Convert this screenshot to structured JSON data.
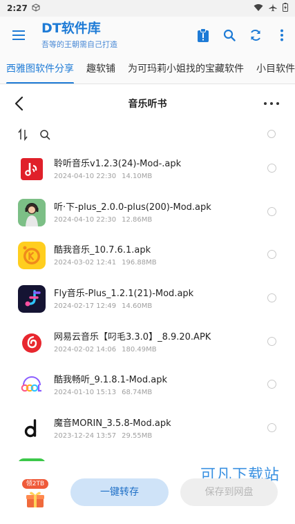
{
  "status_bar": {
    "time": "2:27"
  },
  "app_bar": {
    "title": "DT软件库",
    "subtitle": "吾等的王朝需自己打造"
  },
  "tabs": [
    {
      "label": "西雅图软件分享",
      "active": true
    },
    {
      "label": "趣软铺",
      "active": false
    },
    {
      "label": "为可玛莉小姐找的宝藏软件",
      "active": false
    },
    {
      "label": "小目软件",
      "active": false
    }
  ],
  "folder": {
    "title": "音乐听书"
  },
  "files": [
    {
      "name": "聆听音乐v1.2.3(24)-Mod-.apk",
      "date": "2024-04-10 22:30",
      "size": "14.10MB",
      "icon": "music-note-red-icon"
    },
    {
      "name": "听·下-plus_2.0.0-plus(200)-Mod.apk",
      "date": "2024-04-10 22:30",
      "size": "12.86MB",
      "icon": "girl-headphones-avatar-icon"
    },
    {
      "name": "酷我音乐_10.7.6.1.apk",
      "date": "2024-03-02 12:41",
      "size": "196.88MB",
      "icon": "kuwo-k-icon"
    },
    {
      "name": "Fly音乐-Plus_1.2.1(21)-Mod.apk",
      "date": "2024-02-17 12:49",
      "size": "14.60MB",
      "icon": "fly-f-icon"
    },
    {
      "name": "网易云音乐【叼毛3.3.0】_8.9.20.APK",
      "date": "2024-02-02 14:06",
      "size": "180.49MB",
      "icon": "netease-cloud-music-icon"
    },
    {
      "name": "酷我畅听_9.1.8.1-Mod.apk",
      "date": "2024-01-10 15:13",
      "size": "68.74MB",
      "icon": "cool-headphones-icon"
    },
    {
      "name": "魔音MORIN_3.5.8-Mod.apk",
      "date": "2023-12-24 13:57",
      "size": "29.55MB",
      "icon": "morin-d-icon"
    }
  ],
  "bottom": {
    "gift_badge": "领2TB",
    "save_button": "一键转存",
    "netdisk_button": "保存到网盘",
    "watermark": "可凡下载站"
  },
  "colors": {
    "accent": "#1e7bd6",
    "save_bg": "#cfe3f8",
    "disabled_bg": "#eeeeee"
  }
}
